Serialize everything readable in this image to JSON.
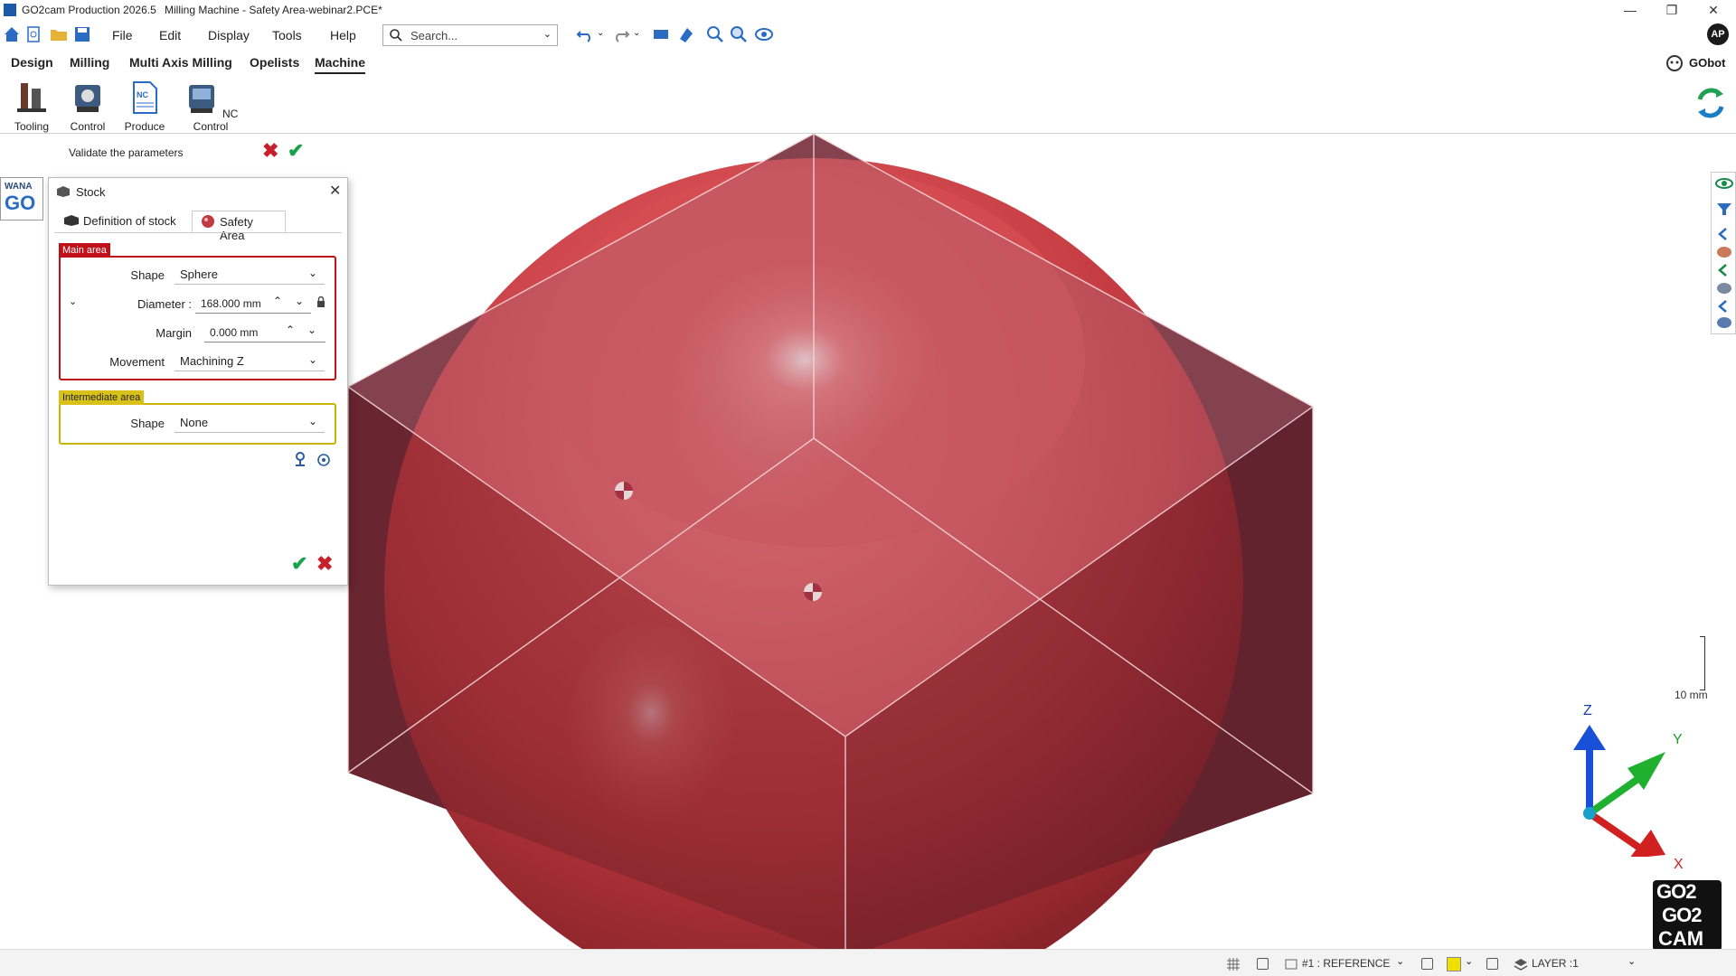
{
  "window": {
    "app_name": "GO2cam Production 2026.5",
    "document_title": "Milling Machine - Safety Area-webinar2.PCE*",
    "minimize_glyph": "—",
    "maximize_glyph": "❐",
    "close_glyph": "✕"
  },
  "menu": {
    "items": [
      "File",
      "Edit",
      "Display",
      "Tools",
      "Help"
    ]
  },
  "search": {
    "placeholder": "Search..."
  },
  "user": {
    "initials": "AP"
  },
  "ribbon_tabs": [
    "Design",
    "Milling",
    "Multi Axis Milling",
    "Opelists",
    "Machine"
  ],
  "active_ribbon_tab": "Machine",
  "gobot": {
    "label": "GObot"
  },
  "ribbon_buttons": [
    {
      "label": "Tooling",
      "icon": "tooling-icon"
    },
    {
      "label": "Control",
      "icon": "control-icon"
    },
    {
      "label": "Produce",
      "icon": "produce-icon"
    },
    {
      "label": "NC Control",
      "icon": "nc-control-icon"
    }
  ],
  "validate_bar": {
    "text": "Validate the parameters"
  },
  "wana_logo": {
    "line1": "WANA",
    "line2": "GO"
  },
  "dialog": {
    "title": "Stock",
    "tabs": [
      {
        "label": "Definition of stock",
        "icon": "stock-definition-icon"
      },
      {
        "label": "Safety Area",
        "icon": "safety-area-icon"
      }
    ],
    "active_tab": "Safety Area",
    "main_area": {
      "label": "Main area",
      "shape_label": "Shape",
      "shape_value": "Sphere",
      "diameter_label": "Diameter :",
      "diameter_value": "168.000 mm",
      "margin_label": "Margin",
      "margin_value": "0.000 mm",
      "movement_label": "Movement",
      "movement_value": "Machining Z"
    },
    "intermediate_area": {
      "label": "Intermediate area",
      "shape_label": "Shape",
      "shape_value": "None"
    }
  },
  "viewport": {
    "scale_label": "10 mm",
    "axis_x": "X",
    "axis_y": "Y",
    "axis_z": "Z",
    "logo_top": "GO2",
    "logo_mid": "GO2",
    "logo_bottom": "CAM"
  },
  "statusbar": {
    "reference": "#1 : REFERENCE",
    "layer": "LAYER :1"
  },
  "colors": {
    "main_area_border": "#c0101a",
    "main_area_label_bg": "#c0101a",
    "intermediate_border": "#c8b400",
    "intermediate_label_bg": "#d8c21a",
    "sphere": "#c83a3e",
    "cube_face": "#8a3a4a",
    "confirm_green": "#18a24a",
    "cancel_red": "#c8202a"
  }
}
